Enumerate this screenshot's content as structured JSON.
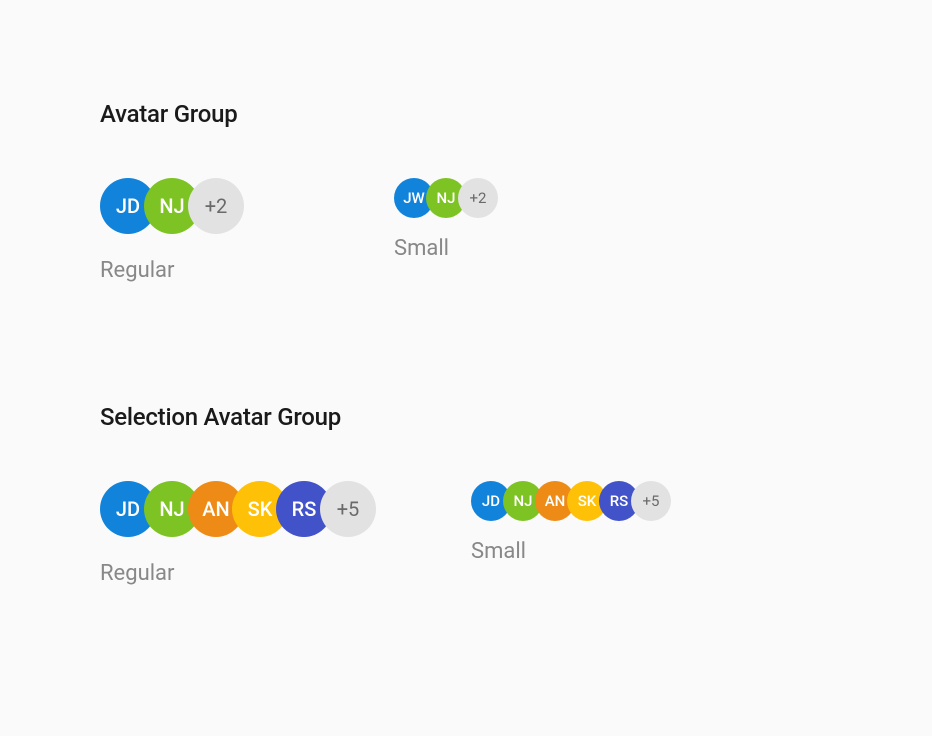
{
  "sections": {
    "avatar_group": {
      "title": "Avatar Group",
      "regular": {
        "label": "Regular",
        "avatars": [
          {
            "initials": "JD",
            "color": "#1283DA"
          },
          {
            "initials": "NJ",
            "color": "#7DC323"
          }
        ],
        "overflow": "+2"
      },
      "small": {
        "label": "Small",
        "avatars": [
          {
            "initials": "JW",
            "color": "#1283DA"
          },
          {
            "initials": "NJ",
            "color": "#7DC323"
          }
        ],
        "overflow": "+2"
      }
    },
    "selection_avatar_group": {
      "title": "Selection Avatar Group",
      "regular": {
        "label": "Regular",
        "avatars": [
          {
            "initials": "JD",
            "color": "#1283DA"
          },
          {
            "initials": "NJ",
            "color": "#7DC323"
          },
          {
            "initials": "AN",
            "color": "#ED8B16"
          },
          {
            "initials": "SK",
            "color": "#FFC107"
          },
          {
            "initials": "RS",
            "color": "#4252C9"
          }
        ],
        "overflow": "+5"
      },
      "small": {
        "label": "Small",
        "avatars": [
          {
            "initials": "JD",
            "color": "#1283DA"
          },
          {
            "initials": "NJ",
            "color": "#7DC323"
          },
          {
            "initials": "AN",
            "color": "#ED8B16"
          },
          {
            "initials": "SK",
            "color": "#FFC107"
          },
          {
            "initials": "RS",
            "color": "#4252C9"
          }
        ],
        "overflow": "+5"
      }
    }
  }
}
